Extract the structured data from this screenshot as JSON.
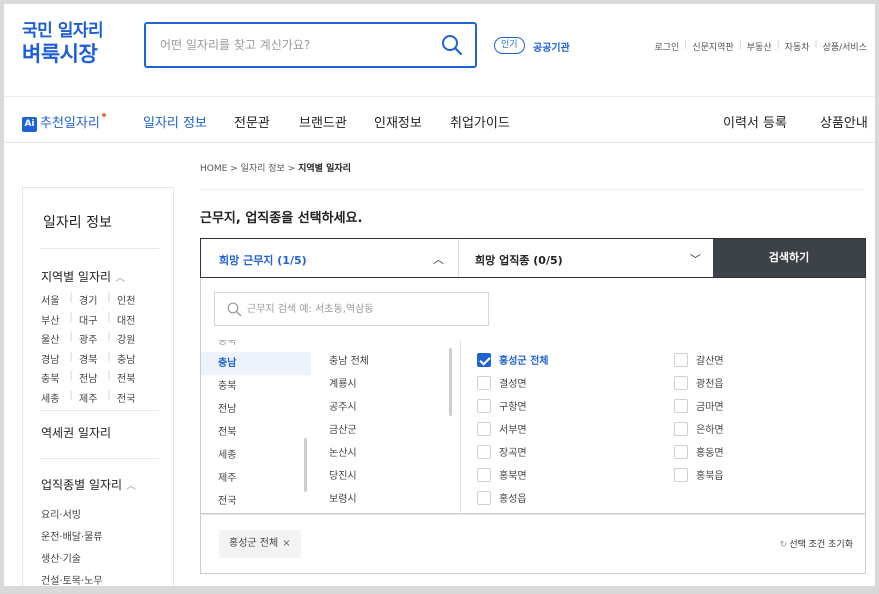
{
  "header": {
    "logo_line1": "국민 일자리",
    "logo_line2": "벼룩시장",
    "search_placeholder": "어떤 일자리를 찾고 계신가요?",
    "popular_badge": "인기",
    "popular_link": "공공기관",
    "util_links": [
      "로그인",
      "신문지역판",
      "부동산",
      "자동차",
      "상품/서비스"
    ]
  },
  "nav": {
    "ai_badge": "Ai",
    "items": [
      "추천일자리",
      "일자리 정보",
      "전문관",
      "브랜드관",
      "인재정보",
      "취업가이드"
    ],
    "right_items": [
      "이력서 등록",
      "상품안내"
    ]
  },
  "sidebar": {
    "title": "일자리 정보",
    "region_heading": "지역별 일자리",
    "regions": [
      [
        "서울",
        "경기",
        "인천"
      ],
      [
        "부산",
        "대구",
        "대전"
      ],
      [
        "울산",
        "광주",
        "강원"
      ],
      [
        "경남",
        "경북",
        "충남"
      ],
      [
        "충북",
        "전남",
        "전북"
      ],
      [
        "세종",
        "제주",
        "전국"
      ]
    ],
    "station_heading": "역세권 일자리",
    "job_heading": "업직종별 일자리",
    "job_items": [
      "요리·서빙",
      "운전·배달·물류",
      "생산·기술",
      "건설·토목·노무"
    ]
  },
  "main": {
    "breadcrumb": [
      "HOME",
      "일자리 정보",
      "지역별 일자리"
    ],
    "title": "근무지, 업직종을 선택하세요.",
    "location_selector": "희망 근무지 (1/5)",
    "job_selector": "희망 업직종 (0/5)",
    "search_button": "검색하기",
    "panel_search_placeholder": "근무지 검색 예: 서초동,역삼동",
    "provinces_partial": "충북",
    "provinces": [
      "충남",
      "충북",
      "전남",
      "전북",
      "세종",
      "제주",
      "전국"
    ],
    "selected_province": "충남",
    "cities": [
      "충남 전체",
      "계룡시",
      "공주시",
      "금산군",
      "논산시",
      "당진시",
      "보령시"
    ],
    "districts_col1": [
      {
        "label": "홍성군 전체",
        "checked": true
      },
      {
        "label": "결성면",
        "checked": false
      },
      {
        "label": "구항면",
        "checked": false
      },
      {
        "label": "서부면",
        "checked": false
      },
      {
        "label": "장곡면",
        "checked": false
      },
      {
        "label": "홍북면",
        "checked": false
      },
      {
        "label": "홍성읍",
        "checked": false
      }
    ],
    "districts_col2": [
      {
        "label": "갈산면",
        "checked": false
      },
      {
        "label": "광천읍",
        "checked": false
      },
      {
        "label": "금마면",
        "checked": false
      },
      {
        "label": "은하면",
        "checked": false
      },
      {
        "label": "홍동면",
        "checked": false
      },
      {
        "label": "홍북읍",
        "checked": false
      }
    ],
    "chip_label": "홍성군 전체",
    "chip_remove": "×",
    "reset_label": "선택 조건 초기화"
  },
  "colors": {
    "accent": "#1f63d6",
    "search_button_bg": "#3d4248"
  }
}
